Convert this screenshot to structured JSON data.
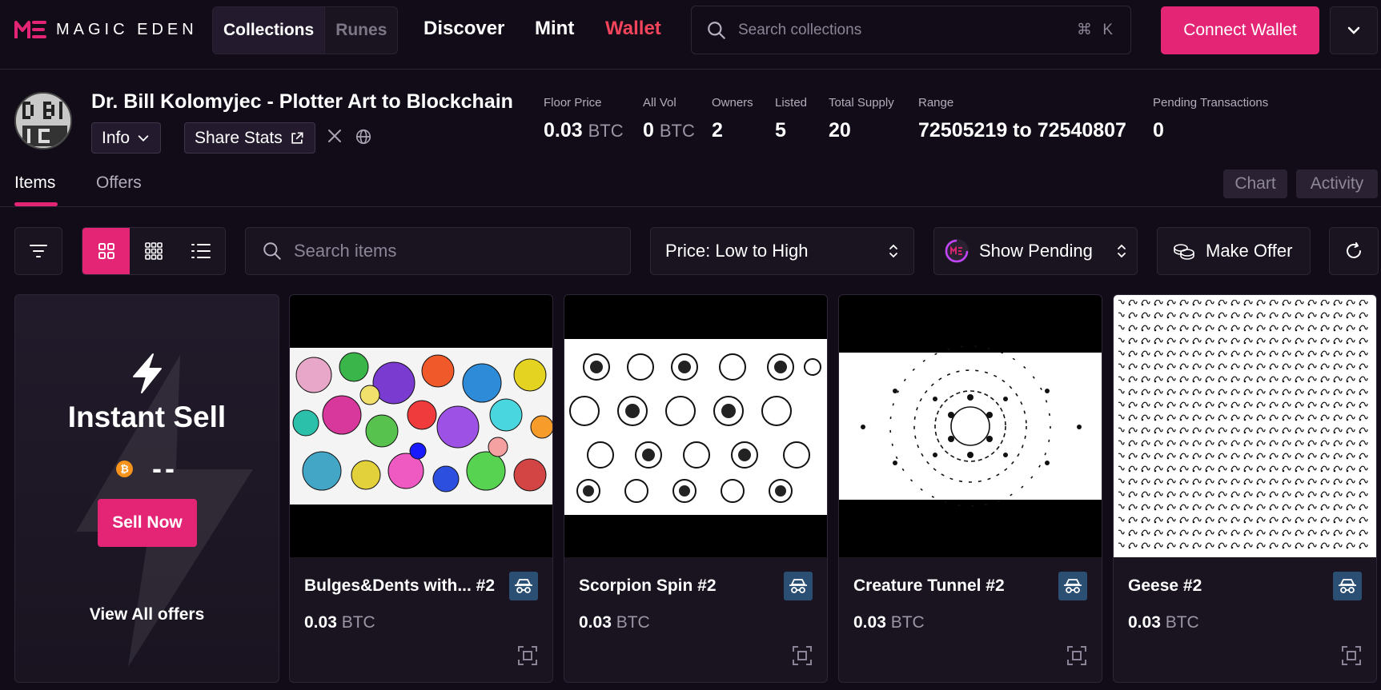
{
  "brand": {
    "name": "MAGIC EDEN",
    "accent": "#e42575"
  },
  "top_nav": {
    "segments": [
      "Collections",
      "Runes"
    ],
    "links": [
      {
        "label": "Discover",
        "color": "#ffffff"
      },
      {
        "label": "Mint",
        "color": "#ffffff"
      },
      {
        "label": "Wallet",
        "color": "#f2445a"
      }
    ],
    "search_placeholder": "Search collections",
    "search_shortcut": "⌘ K",
    "connect_label": "Connect Wallet"
  },
  "collection": {
    "title": "Dr. Bill Kolomyjec - Plotter Art to Blockchain",
    "info_label": "Info",
    "share_label": "Share Stats",
    "stats": [
      {
        "label": "Floor Price",
        "value": "0.03",
        "unit": "BTC"
      },
      {
        "label": "All Vol",
        "value": "0",
        "unit": "BTC"
      },
      {
        "label": "Owners",
        "value": "2",
        "unit": ""
      },
      {
        "label": "Listed",
        "value": "5",
        "unit": ""
      },
      {
        "label": "Total Supply",
        "value": "20",
        "unit": ""
      },
      {
        "label": "Range",
        "value": "72505219 to 72540807",
        "unit": ""
      },
      {
        "label": "Pending Transactions",
        "value": "0",
        "unit": ""
      }
    ]
  },
  "tabs": {
    "items": "Items",
    "offers": "Offers",
    "chart": "Chart",
    "activity": "Activity"
  },
  "toolbar": {
    "search_placeholder": "Search items",
    "sort_value": "Price: Low to High",
    "pending_value": "Show Pending",
    "make_offer": "Make Offer"
  },
  "instant_sell": {
    "title": "Instant Sell",
    "price": "--",
    "sell_now": "Sell Now",
    "view_all": "View All offers"
  },
  "items": [
    {
      "name": "Bulges&Dents with... #2",
      "price": "0.03",
      "unit": "BTC"
    },
    {
      "name": "Scorpion Spin #2",
      "price": "0.03",
      "unit": "BTC"
    },
    {
      "name": "Creature Tunnel #2",
      "price": "0.03",
      "unit": "BTC"
    },
    {
      "name": "Geese #2",
      "price": "0.03",
      "unit": "BTC"
    }
  ]
}
